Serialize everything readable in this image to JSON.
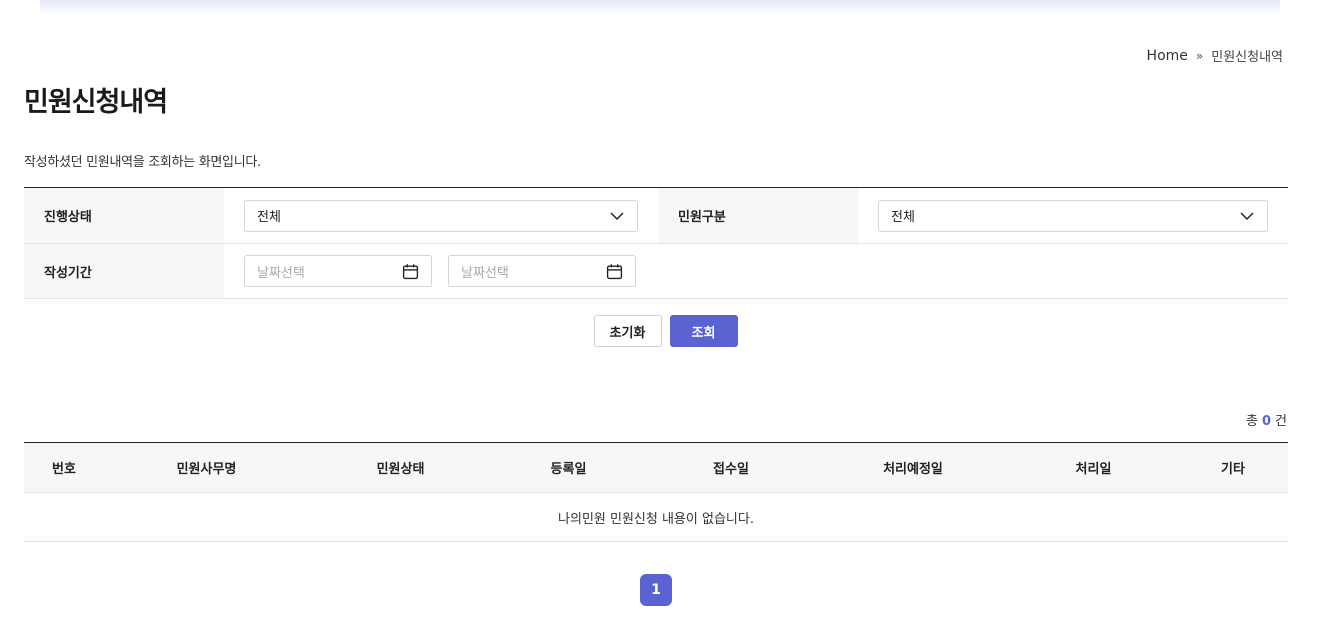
{
  "breadcrumb": {
    "home": "Home",
    "separator": "»",
    "current": "민원신청내역"
  },
  "page": {
    "title": "민원신청내역",
    "description": "작성하셨던 민원내역을 조회하는 화면입니다."
  },
  "search": {
    "status_label": "진행상태",
    "status_value": "전체",
    "type_label": "민원구분",
    "type_value": "전체",
    "period_label": "작성기간",
    "date_start_placeholder": "날짜선택",
    "date_end_placeholder": "날짜선택",
    "reset_label": "초기화",
    "search_label": "조회"
  },
  "summary": {
    "prefix": "총",
    "count": "0",
    "suffix": "건"
  },
  "table": {
    "columns": [
      "번호",
      "민원사무명",
      "민원상태",
      "등록일",
      "접수일",
      "처리예정일",
      "처리일",
      "기타"
    ],
    "empty_message": "나의민원 민원신청 내용이 없습니다."
  },
  "pagination": {
    "current": "1"
  },
  "colors": {
    "accent": "#5b63d3",
    "label_bg": "#f7f7f7",
    "border": "#e4e4e4"
  },
  "icons": {
    "dropdown": "chevron-down-icon",
    "date": "calendar-icon"
  }
}
